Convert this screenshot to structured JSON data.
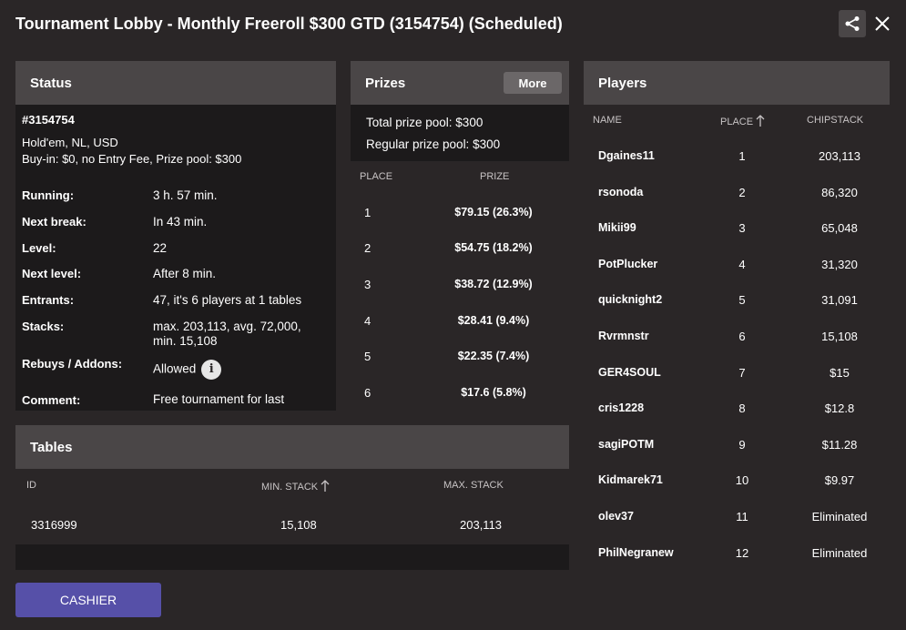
{
  "window": {
    "title": "Tournament Lobby - Monthly Freeroll $300 GTD (3154754) (Scheduled)"
  },
  "icons": {
    "share": "share-icon",
    "close": "close-icon",
    "info": "info-icon",
    "sort_arrow": "arrow-up-icon"
  },
  "status": {
    "header": "Status",
    "id": "#3154754",
    "game": "Hold'em, NL, USD",
    "buyin": "Buy-in: $0, no Entry Fee, Prize pool: $300",
    "rows": [
      {
        "label": "Running:",
        "value": "3 h. 57 min."
      },
      {
        "label": "Next break:",
        "value": "In 43 min."
      },
      {
        "label": "Level:",
        "value": "22"
      },
      {
        "label": "Next level:",
        "value": "After 8 min."
      },
      {
        "label": "Entrants:",
        "value": "47, it's 6 players at 1 tables"
      },
      {
        "label": "Stacks:",
        "value": "max. 203,113, avg. 72,000, min. 15,108"
      },
      {
        "label": "Rebuys / Addons:",
        "value": "Allowed"
      },
      {
        "label": "Comment:",
        "value": "Free tournament for last"
      }
    ]
  },
  "prizes": {
    "header": "Prizes",
    "more_label": "More",
    "total": "Total prize pool: $300",
    "regular": "Regular prize pool: $300",
    "columns": [
      "PLACE",
      "PRIZE"
    ],
    "rows": [
      {
        "place": "1",
        "prize": "$79.15 (26.3%)"
      },
      {
        "place": "2",
        "prize": "$54.75 (18.2%)"
      },
      {
        "place": "3",
        "prize": "$38.72 (12.9%)"
      },
      {
        "place": "4",
        "prize": "$28.41 (9.4%)"
      },
      {
        "place": "5",
        "prize": "$22.35 (7.4%)"
      },
      {
        "place": "6",
        "prize": "$17.6 (5.8%)"
      }
    ]
  },
  "players": {
    "header": "Players",
    "columns": [
      "NAME",
      "PLACE",
      "CHIPSTACK"
    ],
    "rows": [
      {
        "name": "Dgaines11",
        "place": "1",
        "chips": "203,113"
      },
      {
        "name": "rsonoda",
        "place": "2",
        "chips": "86,320"
      },
      {
        "name": "Mikii99",
        "place": "3",
        "chips": "65,048"
      },
      {
        "name": "PotPlucker",
        "place": "4",
        "chips": "31,320"
      },
      {
        "name": "quicknight2",
        "place": "5",
        "chips": "31,091"
      },
      {
        "name": "Rvrmnstr",
        "place": "6",
        "chips": "15,108"
      },
      {
        "name": "GER4SOUL",
        "place": "7",
        "chips": "$15"
      },
      {
        "name": "cris1228",
        "place": "8",
        "chips": "$12.8"
      },
      {
        "name": "sagiPOTM",
        "place": "9",
        "chips": "$11.28"
      },
      {
        "name": "Kidmarek71",
        "place": "10",
        "chips": "$9.97"
      },
      {
        "name": "olev37",
        "place": "11",
        "chips": "Eliminated"
      },
      {
        "name": "PhilNegranew",
        "place": "12",
        "chips": "Eliminated"
      }
    ]
  },
  "tables": {
    "header": "Tables",
    "columns": [
      "ID",
      "MIN. STACK",
      "MAX. STACK"
    ],
    "rows": [
      {
        "id": "3316999",
        "min": "15,108",
        "max": "203,113"
      }
    ]
  },
  "cashier": {
    "label": "CASHIER"
  }
}
